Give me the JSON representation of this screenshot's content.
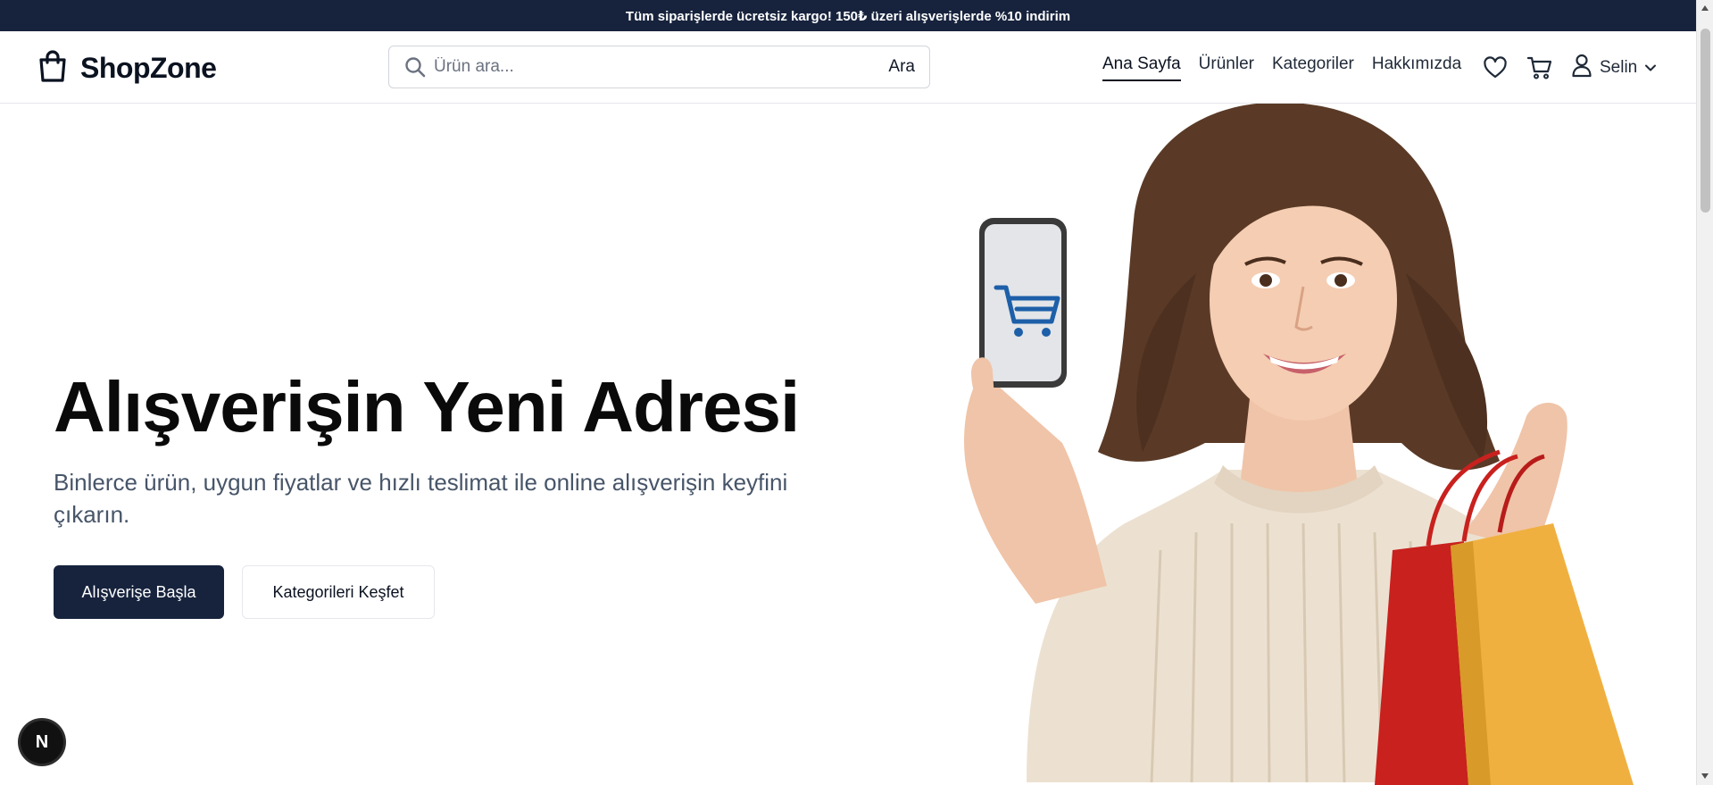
{
  "announcement": {
    "text": "Tüm siparişlerde ücretsiz kargo! 150₺ üzeri alışverişlerde %10 indirim"
  },
  "header": {
    "logo": {
      "icon": "shopping-bag-icon",
      "text": "ShopZone"
    },
    "search": {
      "placeholder": "Ürün ara...",
      "value": "",
      "button": "Ara",
      "icon": "search-icon"
    },
    "nav": [
      {
        "label": "Ana Sayfa",
        "active": true
      },
      {
        "label": "Ürünler",
        "active": false
      },
      {
        "label": "Kategoriler",
        "active": false
      },
      {
        "label": "Hakkımızda",
        "active": false
      }
    ],
    "icons": [
      "heart-icon",
      "cart-icon",
      "user-icon"
    ],
    "user": {
      "name": "Selin"
    }
  },
  "hero": {
    "title": "Alışverişin Yeni Adresi",
    "subtitle": "Binlerce ürün, uygun fiyatlar ve hızlı teslimat ile online alışverişin keyfini çıkarın.",
    "primary_button": "Alışverişe Başla",
    "secondary_button": "Kategorileri Keşfet"
  },
  "badge": {
    "text": "N"
  },
  "colors": {
    "navy": "#17233d",
    "text": "#0a0a0a",
    "subtext": "#475569",
    "border": "#e5e7eb"
  }
}
